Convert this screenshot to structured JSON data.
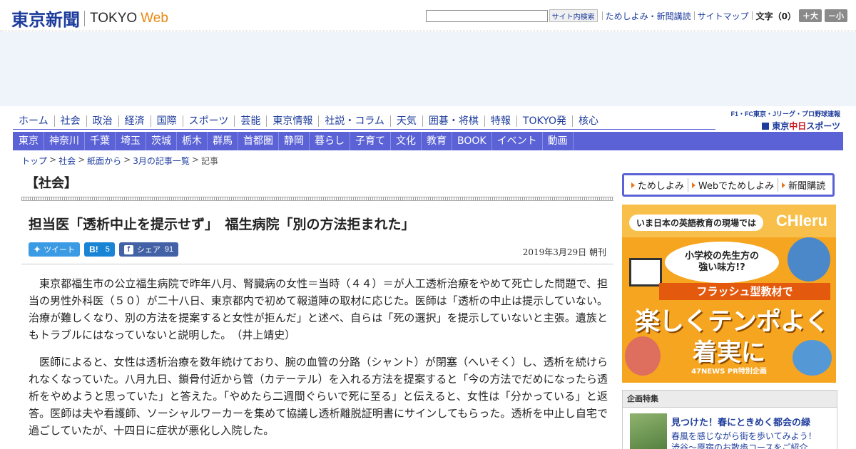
{
  "header": {
    "logo_jp": "東京新聞",
    "logo_en": "TOKYO",
    "logo_web": "Web",
    "search_placeholder": "",
    "search_button": "サイト内検索",
    "links": [
      "ためしよみ・新聞講読",
      "サイトマップ"
    ],
    "font_size_label": "文字（0）",
    "font_larger": "＋大",
    "font_smaller": "－小"
  },
  "main_nav": [
    "ホーム",
    "社会",
    "政治",
    "経済",
    "国際",
    "スポーツ",
    "芸能",
    "東京情報",
    "社説・コラム",
    "天気",
    "囲碁・将棋",
    "特報",
    "TOKYO発",
    "核心"
  ],
  "sports_banner": {
    "top": "F1・FC東京・Jリーグ・プロ野球速報",
    "logo_prefix": "東京",
    "logo_red": "中日",
    "logo_suffix": "スポーツ"
  },
  "region_nav": [
    "東京",
    "神奈川",
    "千葉",
    "埼玉",
    "茨城",
    "栃木",
    "群馬",
    "首都圏",
    "静岡",
    "暮らし",
    "子育て",
    "文化",
    "教育",
    "BOOK",
    "イベント",
    "動画"
  ],
  "breadcrumb": {
    "items": [
      "トップ",
      "社会",
      "紙面から",
      "3月の記事一覧"
    ],
    "current": "記事",
    "separator": ">"
  },
  "article": {
    "section": "【社会】",
    "headline": "担当医「透析中止を提示せず」　福生病院「別の方法拒まれた」",
    "share": {
      "tweet_label": "ツイート",
      "hatena_label": "B!",
      "hatena_count": "5",
      "facebook_label": "シェア",
      "facebook_count": "91"
    },
    "date": "2019年3月29日 朝刊",
    "paragraphs": [
      "東京都福生市の公立福生病院で昨年八月、腎臓病の女性＝当時（４４）＝が人工透析治療をやめて死亡した問題で、担当の男性外科医（５０）が二十八日、東京都内で初めて報道陣の取材に応じた。医師は「透析の中止は提示していない。治療が難しくなり、別の方法を提案すると女性が拒んだ」と述べ、自らは「死の選択」を提示していないと主張。遺族ともトラブルにはなっていないと説明した。　（井上靖史）",
      "医師によると、女性は透析治療を数年続けており、腕の血管の分路（シャント）が閉塞（へいそく）し、透析を続けられなくなっていた。八月九日、鎖骨付近から管（カテーテル）を入れる方法を提案すると「今の方法でだめになったら透析をやめようと思っていた」と答えた。「やめたら二週間ぐらいで死に至る」と伝えると、女性は「分かっている」と返答。医師は夫や看護師、ソーシャルワーカーを集めて協議し透析離脱証明書にサインしてもらった。透析を中止し自宅で過ごしていたが、十四日に症状が悪化し入院した。"
    ]
  },
  "sidebar": {
    "cta": [
      "ためしよみ",
      "Webでためしよみ",
      "新聞購読"
    ],
    "ad": {
      "tagline": "いま日本の英語教育の現場では",
      "brand": "CHIeru",
      "bubble_line1": "小学校の先生方の",
      "bubble_line2": "強い味方!?",
      "ribbon": "フラッシュ型教材で",
      "big_line1": "楽しくテンポよく",
      "big_line2": "着実に",
      "footer": "47NEWS PR特別企画"
    },
    "feature": {
      "heading": "企画特集",
      "title": "見つけた！春にときめく都会の緑",
      "desc_line1": "春風を感じながら街を歩いてみよう！",
      "desc_line2": "渋谷～原宿のお散歩コースをご紹介"
    }
  },
  "colors": {
    "brand_blue": "#1d3c9c",
    "nav_purple": "#5b62d6",
    "web_orange": "#e8870e",
    "twitter": "#3b9ae4",
    "hatena": "#1a84d4",
    "facebook": "#4362a6"
  }
}
